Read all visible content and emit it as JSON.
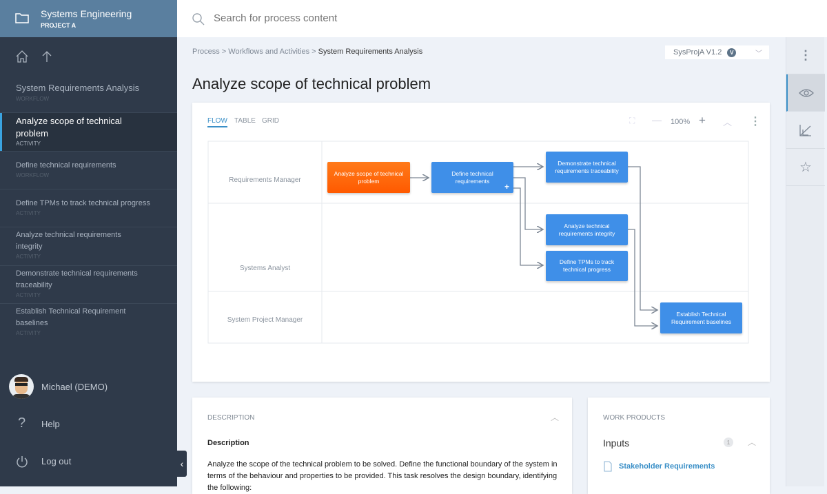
{
  "project": {
    "title": "Systems Engineering",
    "subtitle": "PROJECT A"
  },
  "sidebar": {
    "items": [
      {
        "label": "System Requirements Analysis",
        "kind": "WORKFLOW"
      },
      {
        "label": "Analyze scope of technical problem",
        "kind": "ACTIVITY",
        "active": true
      },
      {
        "label": "Define technical requirements",
        "kind": "WORKFLOW"
      },
      {
        "label": "Define TPMs to track technical progress",
        "kind": "ACTIVITY"
      },
      {
        "label": "Analyze technical requirements integrity",
        "kind": "ACTIVITY"
      },
      {
        "label": "Demonstrate technical requirements traceability",
        "kind": "ACTIVITY"
      },
      {
        "label": "Establish Technical Requirement baselines",
        "kind": "ACTIVITY"
      }
    ],
    "user": "Michael (DEMO)",
    "help": "Help",
    "logout": "Log out"
  },
  "search": {
    "placeholder": "Search for process content"
  },
  "breadcrumb": {
    "items": [
      "Process",
      "Workflows and Activities"
    ],
    "sep": " > ",
    "current": "System Requirements Analysis"
  },
  "version": {
    "label": "SysProjA V1.2",
    "badge": "V"
  },
  "page_title": "Analyze scope of technical problem",
  "diagram": {
    "tabs": [
      "FLOW",
      "TABLE",
      "GRID"
    ],
    "zoom": "100%",
    "lanes": [
      "Requirements Manager",
      "Systems Analyst",
      "System Project Manager"
    ],
    "nodes": {
      "n1": "Analyze scope of technical problem",
      "n2": "Define technical requirements",
      "n3": "Demonstrate technical requirements traceability",
      "n4": "Analyze technical requirements integrity",
      "n5": "Define TPMs to track technical progress",
      "n6": "Establish Technical Requirement baselines"
    },
    "colors": {
      "current": "#ff6a00",
      "node": "#3f8fe8"
    }
  },
  "description": {
    "header": "DESCRIPTION",
    "title": "Description",
    "text": "Analyze the scope of the technical problem to be solved. Define the functional boundary of the system in terms of the behaviour and properties to be provided. This task resolves the design boundary, identifying the following:"
  },
  "work_products": {
    "header": "WORK PRODUCTS",
    "inputs_label": "Inputs",
    "inputs_count": "1",
    "inputs": [
      "Stakeholder Requirements"
    ]
  }
}
